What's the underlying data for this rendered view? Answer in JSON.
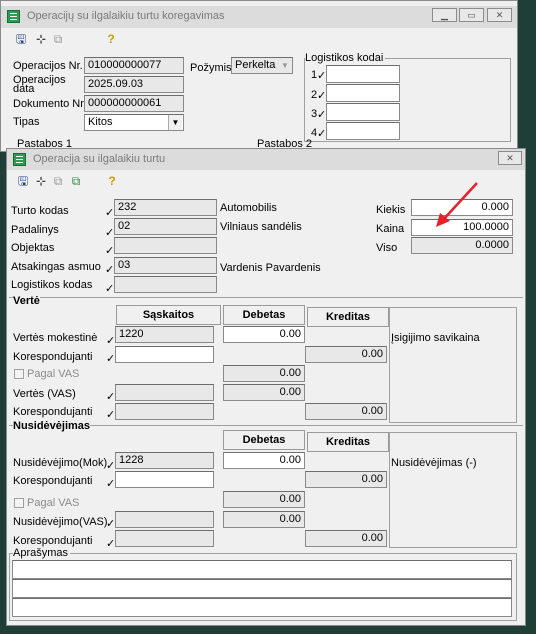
{
  "back_window": {
    "title": "Operacijų su ilgalaikiu turtu koregavimas",
    "labels": {
      "operation_no": "Operacijos Nr.",
      "operation_date": "Operacijos data",
      "document_no": "Dokumento Nr.",
      "type": "Tipas",
      "attribute": "Požymis",
      "logistics_codes": "Logistikos kodai",
      "notes1": "Pastabos 1",
      "notes2": "Pastabos 2"
    },
    "values": {
      "operation_no": "010000000077",
      "operation_date": "2025.09.03",
      "document_no": "000000000061",
      "type": "Kitos",
      "attribute": "Perkelta"
    },
    "logistics_rows": [
      "1",
      "2",
      "3",
      "4"
    ]
  },
  "front_window": {
    "title": "Operacija su ilgalaikiu turtu",
    "labels": {
      "asset_code": "Turto kodas",
      "department": "Padalinys",
      "object": "Objektas",
      "responsible": "Atsakingas asmuo",
      "logistics_code": "Logistikos kodas",
      "quantity": "Kiekis",
      "price": "Kaina",
      "total": "Viso"
    },
    "values": {
      "asset_code": "232",
      "asset_name": "Automobilis",
      "department": "02",
      "department_name": "Vilniaus sandėlis",
      "responsible": "03",
      "responsible_name": "Vardenis Pavardenis",
      "quantity": "0.000",
      "price": "100.0000",
      "total": "0.0000"
    },
    "value_section": {
      "title": "Vertė",
      "col_accounts": "Sąskaitos",
      "col_debit": "Debetas",
      "col_credit": "Kreditas",
      "row1_label": "Vertės mokestinė",
      "row1_account": "1220",
      "row1_debit": "0.00",
      "row2_label": "Korespondujanti",
      "row2_credit": "0.00",
      "vat_check": "Pagal VAS",
      "vat_debit": "0.00",
      "row3_label": "Vertės (VAS)",
      "row3_debit": "0.00",
      "row4_label": "Korespondujanti",
      "row4_credit": "0.00",
      "side_label": "Įsigijimo savikaina"
    },
    "depreciation_section": {
      "title": "Nusidėvėjimas",
      "col_debit": "Debetas",
      "col_credit": "Kreditas",
      "row1_label": "Nusidėvėjimo(Mok)",
      "row1_account": "1228",
      "row1_debit": "0.00",
      "row2_label": "Korespondujanti",
      "row2_credit": "0.00",
      "vat_check": "Pagal VAS",
      "vat_debit": "0.00",
      "row3_label": "Nusidėvėjimo(VAS)",
      "row3_debit": "0.00",
      "row4_label": "Korespondujanti",
      "row4_credit": "0.00",
      "side_label": "Nusidėvėjimas (-)"
    },
    "description": {
      "title": "Aprašymas"
    }
  },
  "colors": {
    "desktop": "#1f3f36",
    "arrow": "#e8202a"
  }
}
